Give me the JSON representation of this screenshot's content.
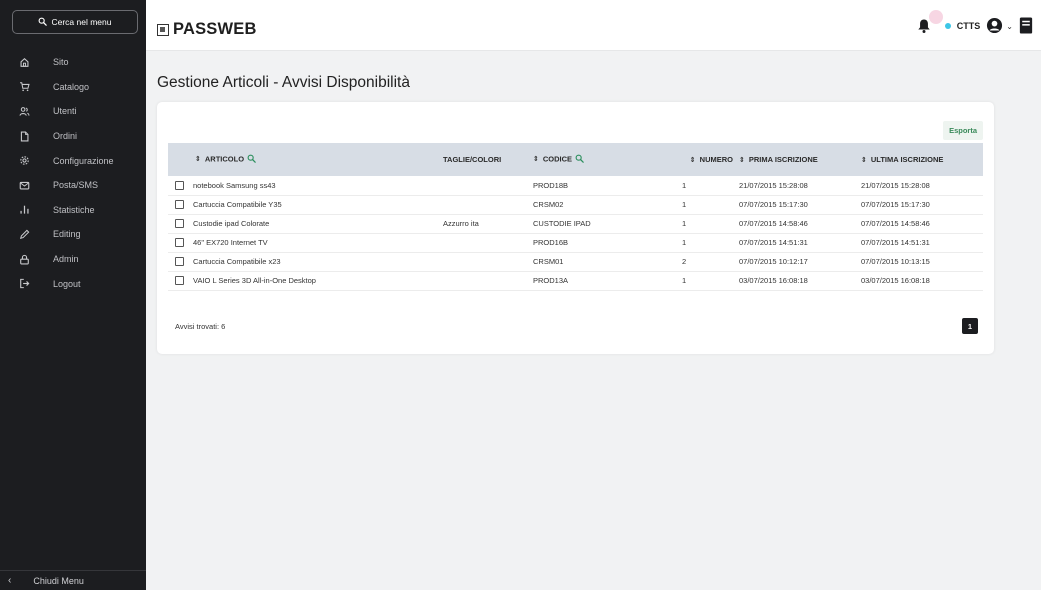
{
  "sidebar": {
    "search_label": "Cerca nel menu",
    "items": [
      {
        "label": "Sito",
        "icon": "home-icon"
      },
      {
        "label": "Catalogo",
        "icon": "cart-icon"
      },
      {
        "label": "Utenti",
        "icon": "users-icon"
      },
      {
        "label": "Ordini",
        "icon": "document-icon"
      },
      {
        "label": "Configurazione",
        "icon": "gear-icon"
      },
      {
        "label": "Posta/SMS",
        "icon": "mail-icon"
      },
      {
        "label": "Statistiche",
        "icon": "stats-icon"
      },
      {
        "label": "Editing",
        "icon": "pencil-icon"
      },
      {
        "label": "Admin",
        "icon": "lock-icon"
      },
      {
        "label": "Logout",
        "icon": "logout-icon"
      }
    ],
    "footer_label": "Chiudi Menu"
  },
  "header": {
    "logo": "PASSWEB",
    "user_code": "CTTS"
  },
  "page": {
    "title": "Gestione Articoli - Avvisi Disponibilità",
    "export_label": "Esporta"
  },
  "table": {
    "headers": {
      "articolo": "ARTICOLO",
      "taglie": "TAGLIE/COLORI",
      "codice": "CODICE",
      "numero": "NUMERO",
      "prima": "PRIMA ISCRIZIONE",
      "ultima": "ULTIMA ISCRIZIONE"
    },
    "rows": [
      {
        "articolo": "notebook Samsung ss43",
        "taglie": "",
        "codice": "PROD18B",
        "numero": "1",
        "prima": "21/07/2015 15:28:08",
        "ultima": "21/07/2015 15:28:08"
      },
      {
        "articolo": "Cartuccia Compatibile Y35",
        "taglie": "",
        "codice": "CRSM02",
        "numero": "1",
        "prima": "07/07/2015 15:17:30",
        "ultima": "07/07/2015 15:17:30"
      },
      {
        "articolo": "Custodie ipad Colorate",
        "taglie": "Azzurro ita",
        "codice": "CUSTODIE IPAD",
        "numero": "1",
        "prima": "07/07/2015 14:58:46",
        "ultima": "07/07/2015 14:58:46"
      },
      {
        "articolo": "46\" EX720 Internet TV",
        "taglie": "",
        "codice": "PROD16B",
        "numero": "1",
        "prima": "07/07/2015 14:51:31",
        "ultima": "07/07/2015 14:51:31"
      },
      {
        "articolo": "Cartuccia Compatibile x23",
        "taglie": "",
        "codice": "CRSM01",
        "numero": "2",
        "prima": "07/07/2015 10:12:17",
        "ultima": "07/07/2015 10:13:15"
      },
      {
        "articolo": "VAIO L Series 3D All-in-One Desktop",
        "taglie": "",
        "codice": "PROD13A",
        "numero": "1",
        "prima": "03/07/2015 16:08:18",
        "ultima": "03/07/2015 16:08:18"
      }
    ],
    "count_label": "Avvisi trovati: 6",
    "current_page": "1"
  }
}
